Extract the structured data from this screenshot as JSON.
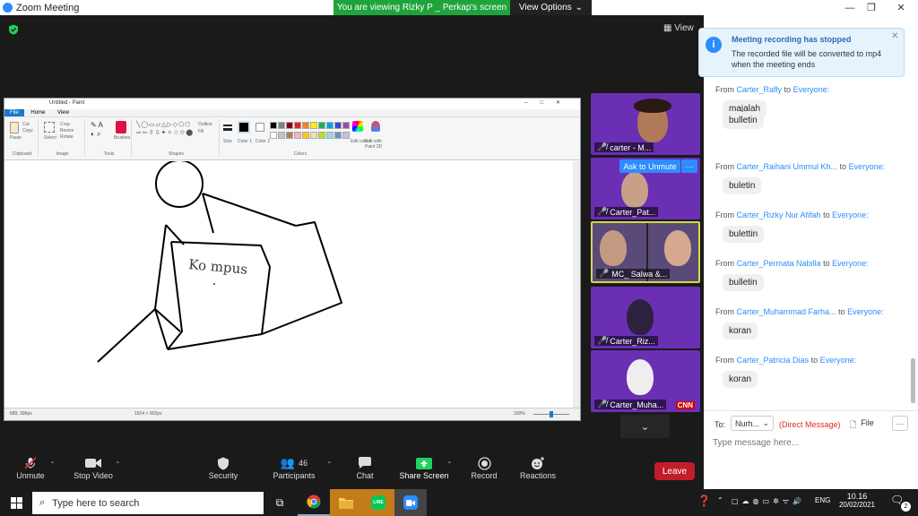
{
  "window": {
    "title": "Zoom Meeting",
    "share_banner": "You are viewing Rizky P _ Perkap's screen",
    "view_options": "View Options"
  },
  "meeting": {
    "view_label": "View"
  },
  "paint": {
    "title": "Untitled - Paint",
    "tabs": [
      "File",
      "Home",
      "View"
    ],
    "groups": [
      "Clipboard",
      "Image",
      "Tools",
      "Shapes",
      "Colors"
    ],
    "tool_labels": {
      "paste": "Paste",
      "cut": "Cut",
      "copy": "Copy",
      "select": "Select",
      "crop": "Crop",
      "resize": "Resize",
      "rotate": "Rotate",
      "brushes": "Brushes",
      "outline": "Outline",
      "fill": "Fill",
      "size": "Size",
      "color1": "Color 1",
      "color2": "Color 2",
      "edit_colors": "Edit colors",
      "edit_paint3d": "Edit with Paint 3D"
    },
    "canvas_text": "Ko mpus",
    "status_pos": "689, 396px",
    "status_size": "1914 × 902px",
    "zoom": "100%",
    "palette": [
      "#000000",
      "#7f7f7f",
      "#880015",
      "#ed1c24",
      "#ff7f27",
      "#fff200",
      "#22b14c",
      "#00a2e8",
      "#3f48cc",
      "#a349a4",
      "#ffffff",
      "#c3c3c3",
      "#b97a57",
      "#ffaec9",
      "#ffc90e",
      "#efe4b0",
      "#b5e61d",
      "#99d9ea",
      "#7092be",
      "#c8bfe7"
    ]
  },
  "tiles": [
    {
      "name": "carter - M...",
      "color": "#7a36c9"
    },
    {
      "name": "Carter_Pat...",
      "color": "#6b2fb3"
    },
    {
      "name": "MC_ Salwa &...",
      "color": "#5a4a7a"
    },
    {
      "name": "Carter_Riz...",
      "color": "#6e2fb5"
    },
    {
      "name": "Carter_Muha...",
      "color": "#7b36c4"
    }
  ],
  "tile_overlay": {
    "ask_to_unmute": "Ask to Unmute",
    "more": "···",
    "cnn": "CNN"
  },
  "toolbar": {
    "unmute": "Unmute",
    "stop_video": "Stop Video",
    "security": "Security",
    "participants": "Participants",
    "participants_count": "46",
    "chat": "Chat",
    "share_screen": "Share Screen",
    "record": "Record",
    "reactions": "Reactions",
    "leave": "Leave"
  },
  "notification": {
    "title": "Meeting recording has stopped",
    "body": "The recorded file will be converted to mp4 when the meeting ends"
  },
  "chat": {
    "messages": [
      {
        "from": "Carter_Rafly",
        "to": "Everyone:",
        "text": "majalah"
      },
      {
        "from": "",
        "to": "",
        "text": "bulletin"
      },
      {
        "from": "Carter_Raihani Ummul Kh...",
        "to": "Everyone:",
        "text": "buletin"
      },
      {
        "from": "Carter_Rizky Nur Afifah",
        "to": "Everyone:",
        "text": "bulettin"
      },
      {
        "from": "Carter_Permata Nabilla",
        "to": "Everyone:",
        "text": "bulletin"
      },
      {
        "from": "Carter_Muhammad Farha...",
        "to": "Everyone:",
        "text": "koran"
      },
      {
        "from": "Carter_Patricia Dias",
        "to": "Everyone:",
        "text": "koran"
      }
    ],
    "from_word": "From",
    "to_word": "to",
    "to_label": "To:",
    "recipient": "Nurh...",
    "direct_message": "(Direct Message)",
    "file_label": "File",
    "more": "···",
    "placeholder": "Type message here..."
  },
  "taskbar": {
    "search_placeholder": "Type here to search",
    "time": "10.16",
    "date": "20/02/2021",
    "lang": "ENG",
    "notif_count": "2"
  }
}
